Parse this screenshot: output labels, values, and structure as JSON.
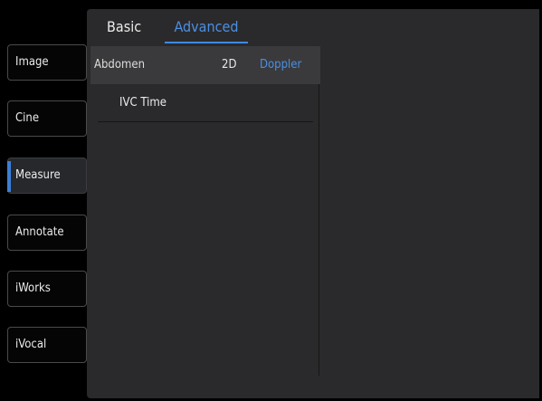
{
  "nav": {
    "items": [
      {
        "label": "Image"
      },
      {
        "label": "Cine"
      },
      {
        "label": "Measure"
      },
      {
        "label": "Annotate"
      },
      {
        "label": "iWorks"
      },
      {
        "label": "iVocal"
      }
    ],
    "active": "Measure"
  },
  "tabs": {
    "basic": "Basic",
    "advanced": "Advanced",
    "selected": "Advanced"
  },
  "subbar": {
    "exam": "Abdomen",
    "mode_2d": "2D",
    "mode_doppler": "Doppler",
    "selected_mode": "Doppler"
  },
  "measurements": {
    "items": [
      "IVC Time"
    ]
  },
  "colors": {
    "accent": "#3b7fd6",
    "panel": "#2a2a2c",
    "subbar": "#3a3a3c",
    "background": "#000000"
  }
}
